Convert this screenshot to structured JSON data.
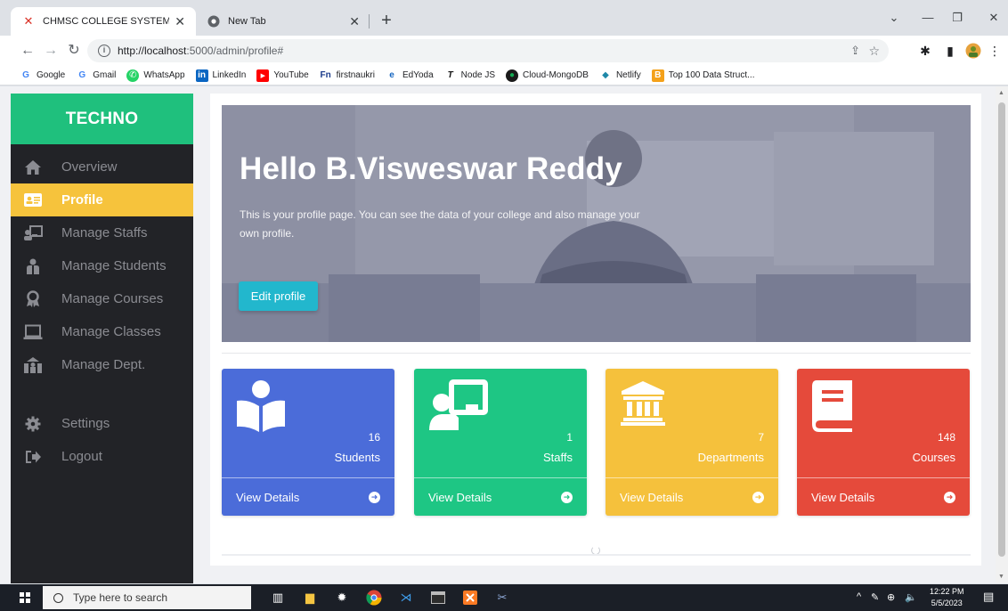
{
  "browser": {
    "tabs": [
      {
        "title": "CHMSC COLLEGE SYSTEM",
        "active": true
      },
      {
        "title": "New Tab",
        "active": false
      }
    ],
    "url_host": "http://localhost",
    "url_path": ":5000/admin/profile#",
    "bookmarks": [
      {
        "label": "Google",
        "icon": "google-icon",
        "color": "#4285f4"
      },
      {
        "label": "Gmail",
        "icon": "google-icon",
        "color": "#4285f4"
      },
      {
        "label": "WhatsApp",
        "icon": "whatsapp-icon",
        "color": "#25d366"
      },
      {
        "label": "LinkedIn",
        "icon": "linkedin-icon",
        "color": "#0a66c2"
      },
      {
        "label": "YouTube",
        "icon": "youtube-icon",
        "color": "#ff0000"
      },
      {
        "label": "firstnaukri",
        "icon": "firstnaukri-icon",
        "color": "#1a3a8a"
      },
      {
        "label": "EdYoda",
        "icon": "edyoda-icon",
        "color": "#1565c0"
      },
      {
        "label": "Node JS",
        "icon": "nodejs-icon",
        "color": "#111111"
      },
      {
        "label": "Cloud-MongoDB",
        "icon": "mongodb-icon",
        "color": "#116149"
      },
      {
        "label": "Netlify",
        "icon": "netlify-icon",
        "color": "#1e88a8"
      },
      {
        "label": "Top 100 Data Struct...",
        "icon": "bookmark-b-icon",
        "color": "#f4a11a"
      }
    ]
  },
  "sidebar": {
    "brand": "TECHNO",
    "items": [
      {
        "label": "Overview",
        "icon": "home-icon",
        "active": false
      },
      {
        "label": "Profile",
        "icon": "id-card-icon",
        "active": true
      },
      {
        "label": "Manage Staffs",
        "icon": "chalkboard-teacher-icon",
        "active": false
      },
      {
        "label": "Manage Students",
        "icon": "user-graduate-icon",
        "active": false
      },
      {
        "label": "Manage Courses",
        "icon": "award-icon",
        "active": false
      },
      {
        "label": "Manage Classes",
        "icon": "laptop-icon",
        "active": false
      },
      {
        "label": "Manage Dept.",
        "icon": "users-building-icon",
        "active": false
      },
      {
        "label": "Settings",
        "icon": "gear-icon",
        "active": false
      },
      {
        "label": "Logout",
        "icon": "logout-icon",
        "active": false
      }
    ]
  },
  "hero": {
    "greeting": "Hello B.Visweswar Reddy",
    "description": "This is your profile page. You can see the data of your college and also manage your own profile.",
    "edit_button": "Edit profile"
  },
  "cards": [
    {
      "count": "16",
      "label": "Students",
      "footer": "View Details",
      "icon": "book-reader-icon",
      "color": "#4b6cd9"
    },
    {
      "count": "1",
      "label": "Staffs",
      "footer": "View Details",
      "icon": "chalkboard-teacher-icon",
      "color": "#1ec684"
    },
    {
      "count": "7",
      "label": "Departments",
      "footer": "View Details",
      "icon": "university-icon",
      "color": "#f5c13c"
    },
    {
      "count": "148",
      "label": "Courses",
      "footer": "View Details",
      "icon": "book-icon",
      "color": "#e54a3b"
    }
  ],
  "taskbar": {
    "search_placeholder": "Type here to search",
    "time": "12:22 PM",
    "date": "5/5/2023"
  }
}
